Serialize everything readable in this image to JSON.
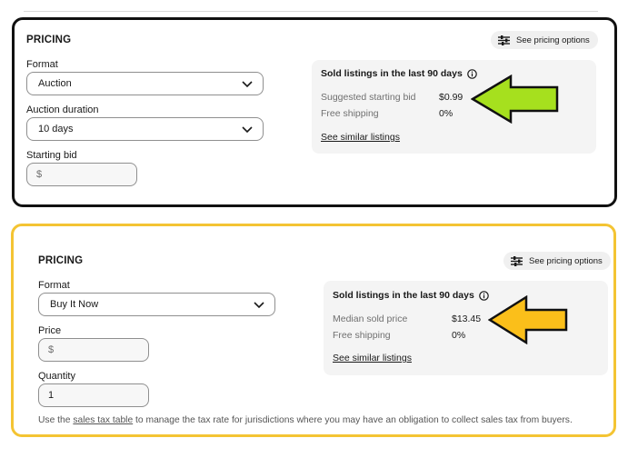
{
  "colors": {
    "panel1_border": "#111111",
    "panel2_border": "#f4c433",
    "arrow1_fill": "#a6e01e",
    "arrow2_fill": "#fbbf1a",
    "info_box_bg": "#f4f4f4",
    "pill_bg": "#f0f0f0"
  },
  "panel1": {
    "title": "PRICING",
    "pricing_options_label": "See pricing options",
    "pricing_options_icon": "sliders-icon",
    "format": {
      "label": "Format",
      "value": "Auction"
    },
    "duration": {
      "label": "Auction duration",
      "value": "10 days"
    },
    "starting_bid": {
      "label": "Starting bid",
      "placeholder": "$"
    },
    "sold": {
      "title": "Sold listings in the last 90 days",
      "rows": [
        {
          "label": "Suggested starting bid",
          "value": "$0.99"
        },
        {
          "label": "Free shipping",
          "value": "0%"
        }
      ],
      "link": "See similar listings"
    },
    "arrow_icon": "left-arrow-icon"
  },
  "panel2": {
    "title": "PRICING",
    "pricing_options_label": "See pricing options",
    "pricing_options_icon": "sliders-icon",
    "format": {
      "label": "Format",
      "value": "Buy It Now"
    },
    "price": {
      "label": "Price",
      "placeholder": "$"
    },
    "quantity": {
      "label": "Quantity",
      "value": "1"
    },
    "sold": {
      "title": "Sold listings in the last 90 days",
      "rows": [
        {
          "label": "Median sold price",
          "value": "$13.45"
        },
        {
          "label": "Free shipping",
          "value": "0%"
        }
      ],
      "link": "See similar listings"
    },
    "footnote": {
      "prefix": "Use the ",
      "link": "sales tax table",
      "suffix": " to manage the tax rate for jurisdictions where you may have an obligation to collect sales tax from buyers."
    },
    "arrow_icon": "left-arrow-icon"
  }
}
